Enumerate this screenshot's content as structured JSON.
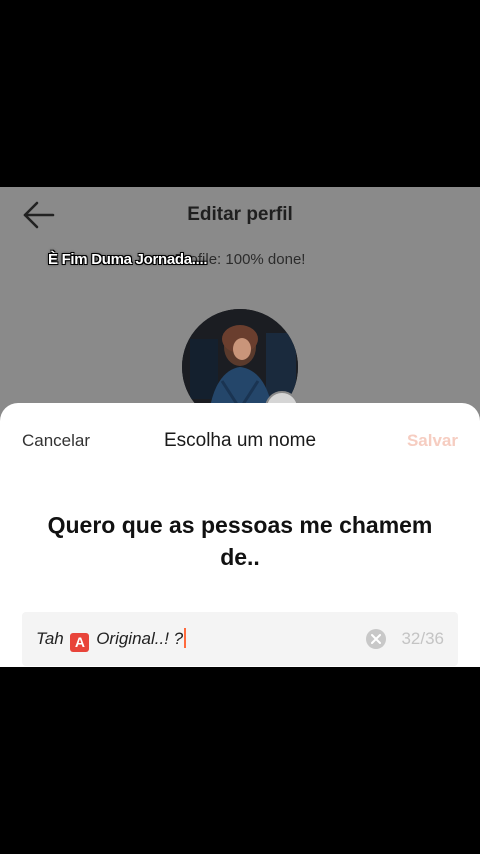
{
  "header": {
    "title": "Editar perfil",
    "back_icon": "arrow-left-icon"
  },
  "progress": {
    "text": "Profile: 100% done!",
    "percent": 100
  },
  "overlay": {
    "caption": "È Fim Duma Jornada...."
  },
  "avatar": {
    "edit_icon": "camera-icon"
  },
  "sheet": {
    "cancel_label": "Cancelar",
    "title": "Escolha um nome",
    "save_label": "Salvar",
    "prompt": "Quero que as pessoas me chamem de..",
    "input": {
      "prefix": "Tah ",
      "badge": "A",
      "suffix": " Original..! ?",
      "clear_icon": "clear-circle-icon",
      "char_count": "32/36"
    }
  },
  "colors": {
    "save_disabled": "#f6cdc1",
    "badge": "#e8443a",
    "caret": "#ff6a3d"
  }
}
